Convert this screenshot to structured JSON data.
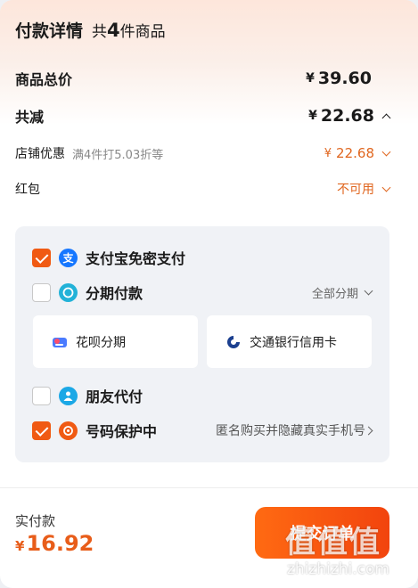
{
  "header": {
    "title": "付款详情",
    "count_prefix": "共",
    "count_num": "4",
    "count_suffix": "件商品"
  },
  "summary": {
    "goods_total_label": "商品总价",
    "goods_total_currency": "¥",
    "goods_total_value": "39.60",
    "discount_label": "共减",
    "discount_currency": "¥",
    "discount_value": "22.68"
  },
  "store_discount": {
    "label": "店铺优惠",
    "desc": "满4件打5.03折等",
    "currency": "¥",
    "value": "22.68"
  },
  "red_packet": {
    "label": "红包",
    "value": "不可用"
  },
  "payment": {
    "alipay": {
      "label": "支付宝免密支付",
      "checked": true,
      "icon": "alipay-icon"
    },
    "installment": {
      "label": "分期付款",
      "checked": false,
      "right_label": "全部分期",
      "icon": "installment-icon"
    },
    "cards": [
      {
        "label": "花呗分期",
        "icon": "huabei-icon"
      },
      {
        "label": "交通银行信用卡",
        "icon": "bocom-icon"
      }
    ],
    "friend": {
      "label": "朋友代付",
      "checked": false,
      "icon": "friend-pay-icon"
    },
    "privacy": {
      "label": "号码保护中",
      "checked": true,
      "right_label": "匿名购买并隐藏真实手机号",
      "icon": "phone-protect-icon"
    }
  },
  "footer": {
    "label": "实付款",
    "currency": "¥",
    "value": "16.92",
    "submit_label": "提交订单"
  },
  "watermark": {
    "glyphs": "值值值",
    "url": "zhizhizhi.com"
  },
  "colors": {
    "accent": "#f05a13",
    "price": "#e0661f",
    "panel": "#f0f2f6"
  }
}
